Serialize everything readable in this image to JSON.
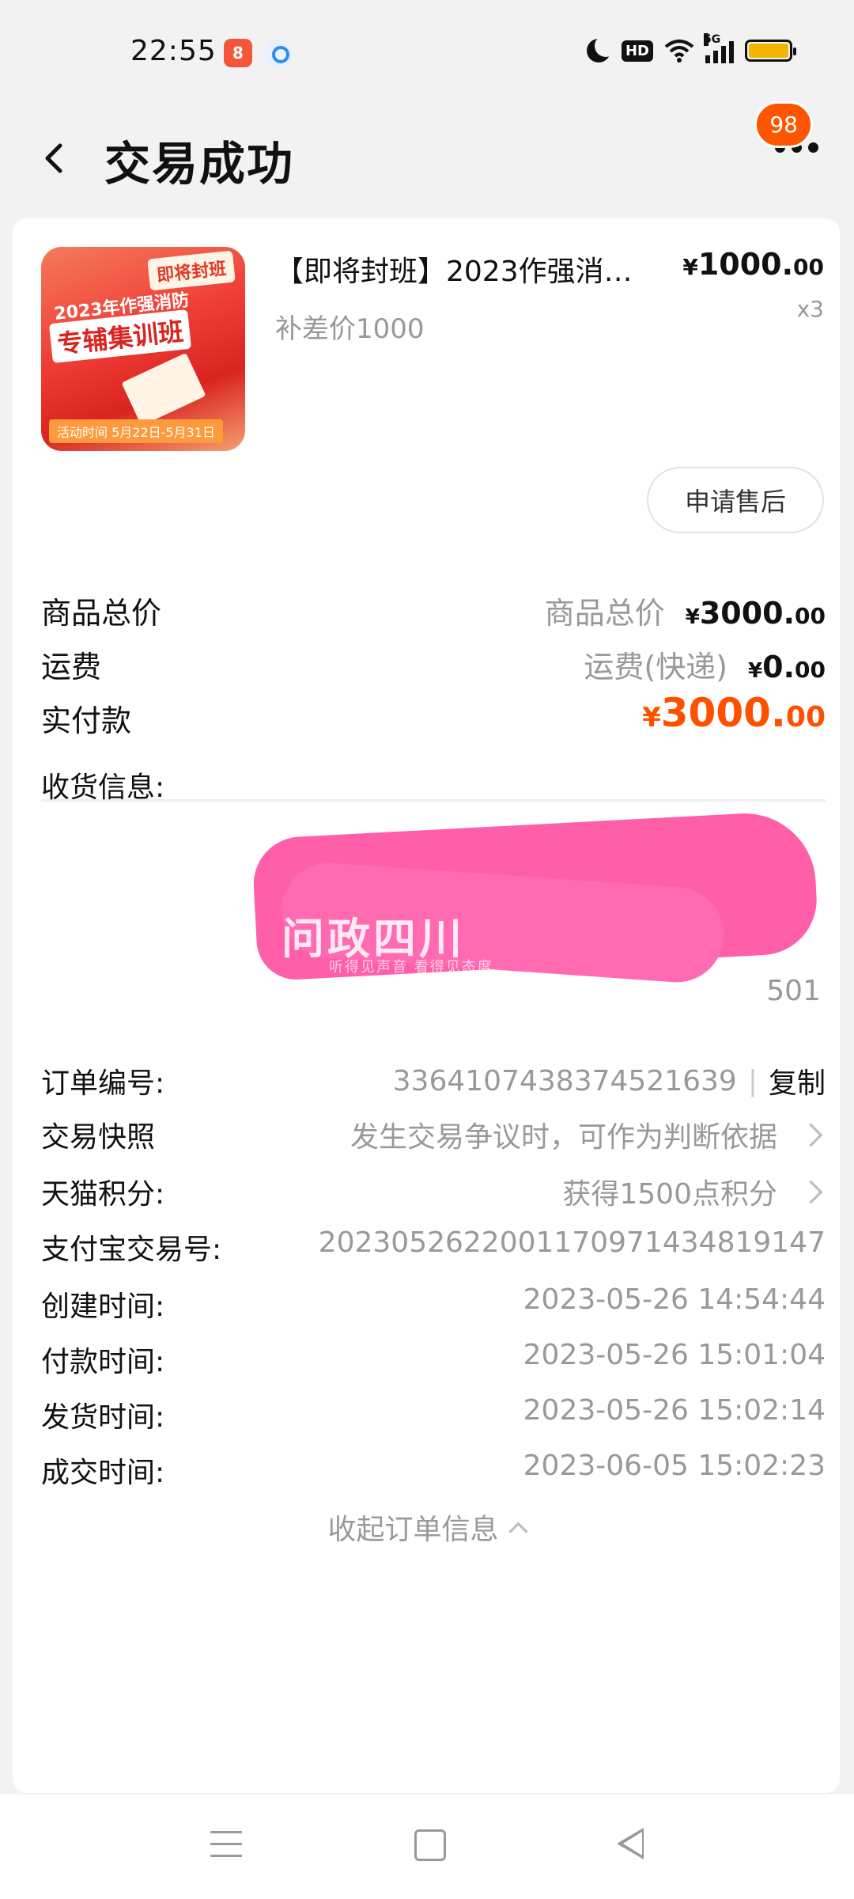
{
  "status_bar": {
    "time": "22:55",
    "app_badge": "8",
    "network": "5G"
  },
  "header": {
    "title": "交易成功",
    "badge_count": "98"
  },
  "product": {
    "name": "【即将封班】2023作强消…",
    "subtitle": "补差价1000",
    "price_symbol": "¥",
    "price_int": "1000.",
    "price_dec": "00",
    "qty": "x3",
    "thumb": {
      "tag": "即将封班",
      "line1": "2023年作强消防",
      "line2": "专辅集训班",
      "foot": "活动时间 5月22日-5月31日"
    },
    "after_sale": "申请售后"
  },
  "summary": {
    "total": {
      "label": "商品总价",
      "note": "商品总价",
      "symbol": "¥",
      "int": "3000.",
      "dec": "00"
    },
    "shipping": {
      "label": "运费",
      "note": "运费(快递)",
      "symbol": "¥",
      "int": "0.",
      "dec": "00"
    },
    "paid": {
      "label": "实付款",
      "symbol": "¥",
      "int": "3000.",
      "dec": "00"
    }
  },
  "order_info": {
    "address_label": "收货信息:",
    "address_tail": "501",
    "watermark": "问政四川",
    "watermark_sub": "听得见声音 看得见态度",
    "order_no": {
      "label": "订单编号:",
      "value": "3364107438374521639",
      "sep": "|",
      "copy": "复制"
    },
    "snapshot": {
      "label": "交易快照",
      "value": "发生交易争议时，可作为判断依据"
    },
    "points": {
      "label": "天猫积分:",
      "value": "获得1500点积分"
    },
    "alipay": {
      "label": "支付宝交易号:",
      "value": "2023052622001170971434819147"
    },
    "created": {
      "label": "创建时间:",
      "value": "2023-05-26 14:54:44"
    },
    "paid_time": {
      "label": "付款时间:",
      "value": "2023-05-26 15:01:04"
    },
    "shipped": {
      "label": "发货时间:",
      "value": "2023-05-26 15:02:14"
    },
    "completed": {
      "label": "成交时间:",
      "value": "2023-06-05 15:02:23"
    },
    "collapse": "收起订单信息"
  },
  "colors": {
    "accent": "#ff5000",
    "badge": "#ff5500",
    "redaction": "#ff5fa8"
  }
}
